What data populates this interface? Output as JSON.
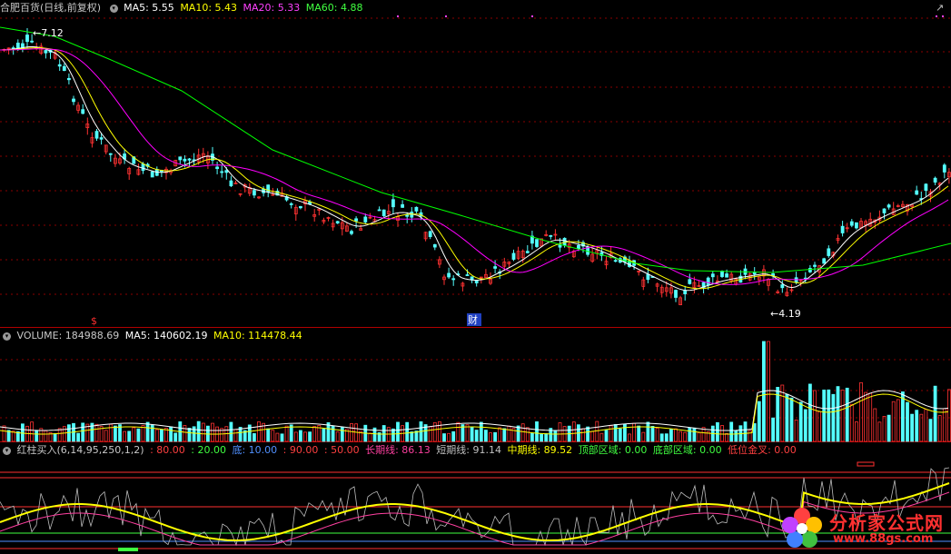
{
  "main": {
    "title": "合肥百货(日线,前复权)",
    "ma5": "MA5: 5.55",
    "ma10": "MA10: 5.43",
    "ma20": "MA20: 5.33",
    "ma60": "MA60: 4.88",
    "high_label": "7.12",
    "low_label": "4.19",
    "marker_s": "$",
    "marker_cai": "财"
  },
  "volume": {
    "label": "VOLUME: 184988.69",
    "ma5": "MA5: 140602.19",
    "ma10": "MA10: 114478.44"
  },
  "indicator": {
    "name": "红柱买入(6,14,95,250,1,2)",
    "l80": ": 80.00",
    "l20": ": 20.00",
    "di": "底: 10.00",
    "l90": ": 90.00",
    "l50": ": 50.00",
    "long": "长期线: 86.13",
    "short": "短期线: 91.14",
    "mid": "中期线: 89.52",
    "top_zone": "顶部区域: 0.00",
    "bottom_zone": "底部区域: 0.00",
    "golden": "低位金叉: 0.00"
  },
  "watermark": {
    "brand": "分析家公式网",
    "url": "www.88gs.com"
  },
  "colors": {
    "up": "#ff3232",
    "down": "#54ffff",
    "ma5": "#ffffff",
    "ma10": "#ffff00",
    "ma20": "#ff00ff",
    "ma60": "#00ff00"
  }
}
